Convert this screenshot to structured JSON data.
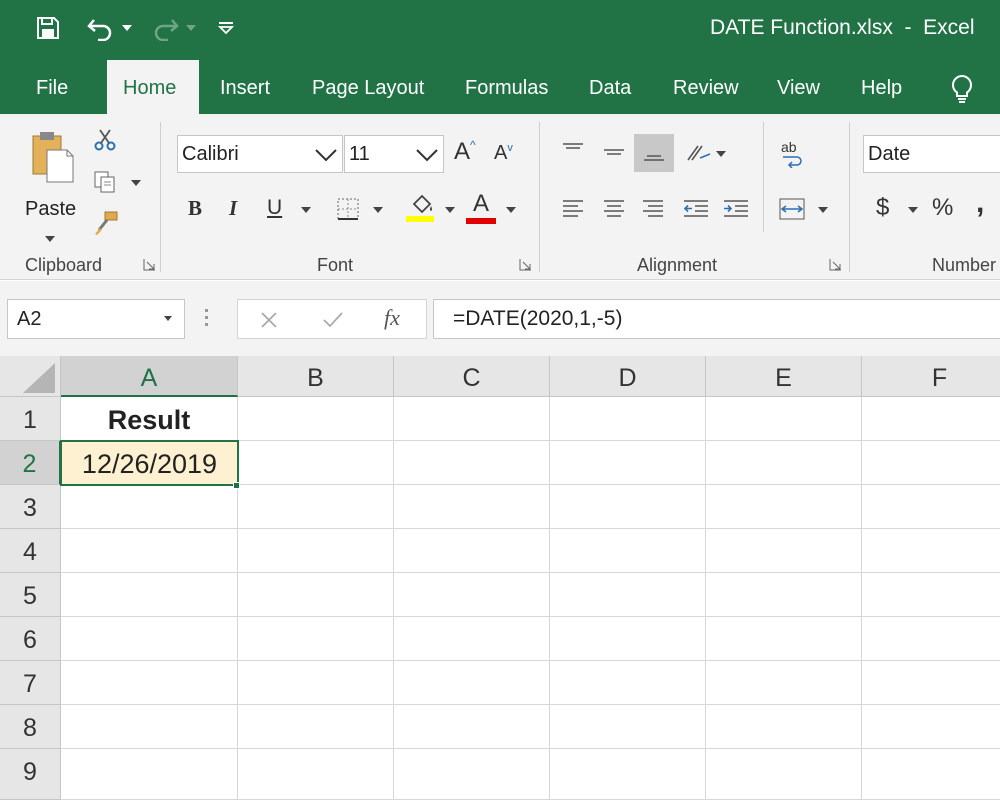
{
  "titlebar": {
    "document_title": "DATE Function.xlsx  -  Excel",
    "bg_color": "#217346"
  },
  "tabs": [
    "File",
    "Home",
    "Insert",
    "Page Layout",
    "Formulas",
    "Data",
    "Review",
    "View",
    "Help"
  ],
  "active_tab": "Home",
  "ribbon": {
    "clipboard": {
      "group_label": "Clipboard",
      "paste_label": "Paste"
    },
    "font": {
      "group_label": "Font",
      "font_name": "Calibri",
      "font_size": "11",
      "bold": "B",
      "italic": "I",
      "underline": "U",
      "grow_font": "A",
      "shrink_font": "A",
      "font_color": "A",
      "highlight_color": "#ffff00",
      "text_color": "#e00000"
    },
    "alignment": {
      "group_label": "Alignment",
      "wrap_text_glyph": "ab"
    },
    "number": {
      "group_label": "Number",
      "format_value": "Date",
      "currency": "$",
      "percent": "%",
      "comma": ","
    }
  },
  "formula_bar": {
    "name_box": "A2",
    "fx": "fx",
    "formula": "=DATE(2020,1,-5)"
  },
  "grid": {
    "columns": [
      "A",
      "B",
      "C",
      "D",
      "E",
      "F"
    ],
    "rows": [
      "1",
      "2",
      "3",
      "4",
      "5",
      "6",
      "7",
      "8",
      "9"
    ],
    "selected_cell": "A2",
    "cells": {
      "A1": "Result",
      "A2": "12/26/2019"
    },
    "selected_fill": "#fdf1d1"
  },
  "icons": [
    "save-icon",
    "undo-icon",
    "redo-icon",
    "customize-qat-icon",
    "lightbulb-icon",
    "paste-icon",
    "cut-icon",
    "copy-icon",
    "format-painter-icon",
    "borders-icon",
    "fill-color-icon",
    "orientation-icon",
    "wrap-text-icon",
    "merge-center-icon",
    "cancel-icon",
    "enter-icon",
    "insert-function-icon",
    "select-all-icon"
  ]
}
